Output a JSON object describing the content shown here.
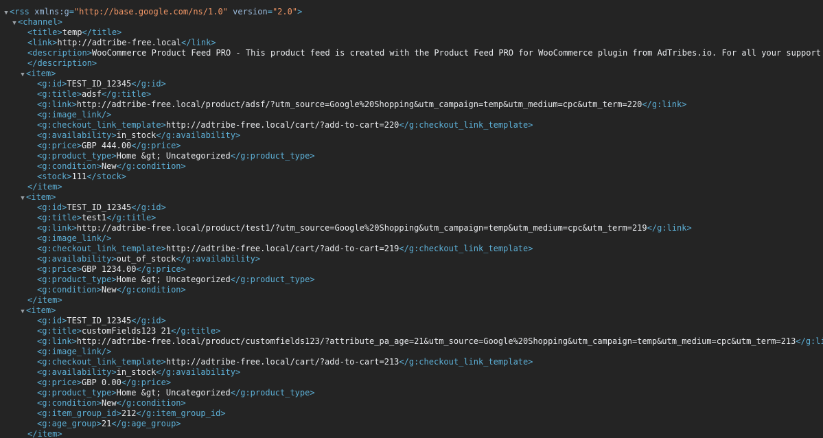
{
  "rss": {
    "attr1_name": "xmlns:g",
    "attr1_value": "\"http://base.google.com/ns/1.0\"",
    "attr2_name": "version",
    "attr2_value": "\"2.0\""
  },
  "channel": {
    "title": "temp",
    "link": "http://adtribe-free.local",
    "description": "WooCommerce Product Feed PRO - This product feed is created with the Product Feed PRO for WooCommerce plugin from AdTribes.io. For all your support q"
  },
  "items": [
    {
      "id": "TEST_ID_12345",
      "title": "adsf",
      "link": "http://adtribe-free.local/product/adsf/?utm_source=Google%20Shopping&utm_campaign=temp&utm_medium=cpc&utm_term=220",
      "checkout_link_template": "http://adtribe-free.local/cart/?add-to-cart=220",
      "availability": "in_stock",
      "price": "GBP 444.00",
      "product_type": "Home &gt; Uncategorized",
      "condition": "New",
      "stock": "111"
    },
    {
      "id": "TEST_ID_12345",
      "title": "test1",
      "link": "http://adtribe-free.local/product/test1/?utm_source=Google%20Shopping&utm_campaign=temp&utm_medium=cpc&utm_term=219",
      "checkout_link_template": "http://adtribe-free.local/cart/?add-to-cart=219",
      "availability": "out_of_stock",
      "price": "GBP 1234.00",
      "product_type": "Home &gt; Uncategorized",
      "condition": "New"
    },
    {
      "id": "TEST_ID_12345",
      "title": "customFields123 21",
      "link": "http://adtribe-free.local/product/customfields123/?attribute_pa_age=21&utm_source=Google%20Shopping&utm_campaign=temp&utm_medium=cpc&utm_term=213",
      "checkout_link_template": "http://adtribe-free.local/cart/?add-to-cart=213",
      "availability": "in_stock",
      "price": "GBP 0.00",
      "product_type": "Home &gt; Uncategorized",
      "condition": "New",
      "item_group_id": "212",
      "age_group": "21"
    }
  ],
  "ui": {
    "toggle_glyph": "▼"
  }
}
